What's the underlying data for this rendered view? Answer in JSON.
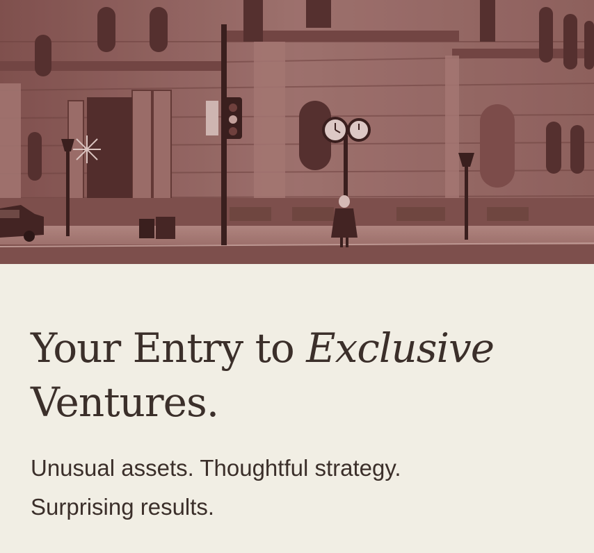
{
  "hero": {
    "image_description_icon": "building-photo-icon",
    "tint_color": "#8a5a58"
  },
  "headline": {
    "part1": "Your Entry to ",
    "emphasis": "Exclusive",
    "part2": "Ventures."
  },
  "subline": {
    "line1": "Unusual assets. Thoughtful strategy.",
    "line2": "Surprising results."
  },
  "colors": {
    "background": "#f1eee4",
    "text": "#3b2f2a",
    "tint": "#8a5a58"
  }
}
